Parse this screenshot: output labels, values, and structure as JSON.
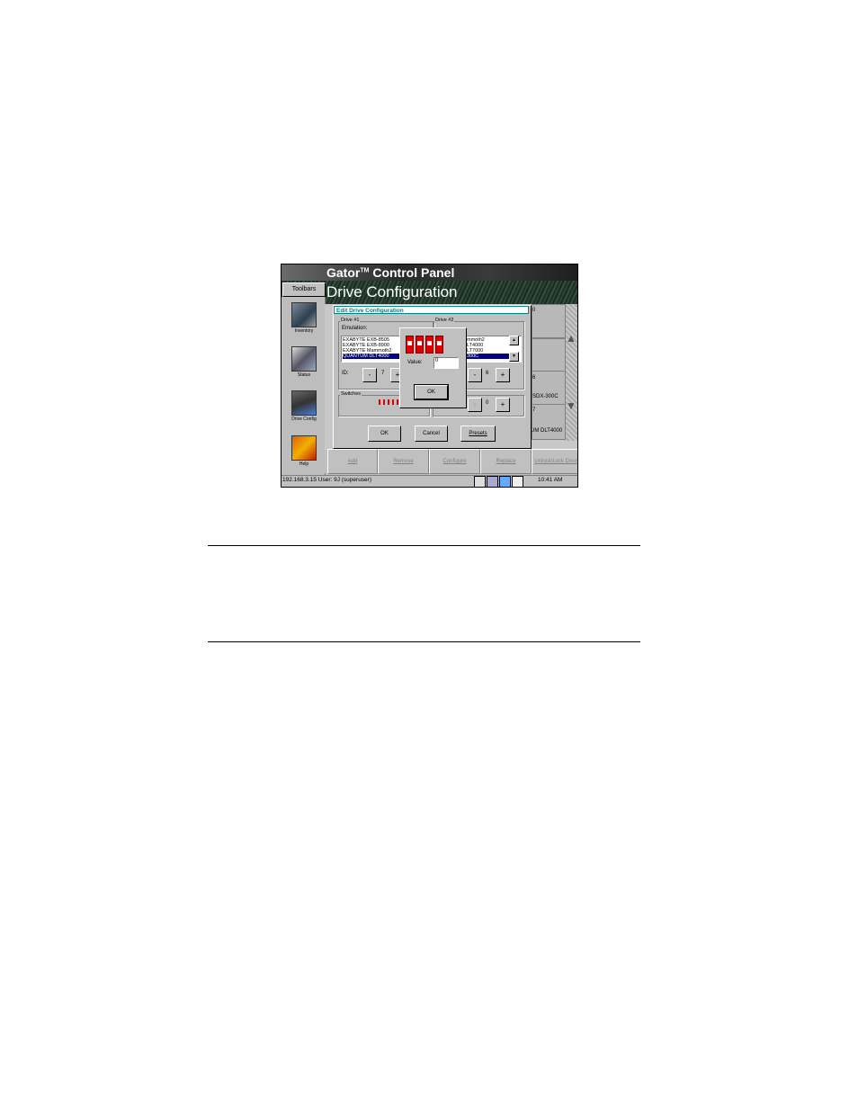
{
  "header": {
    "app_title": "Gator",
    "tm": "TM",
    "app_title_rest": " Control Panel",
    "page_title": "Drive Configuration",
    "toolbars_label": "Toolbars"
  },
  "toolbar": {
    "items": [
      {
        "label": "Inventory",
        "icon": "inventory-icon"
      },
      {
        "label": "Status",
        "icon": "status-icon"
      },
      {
        "label": "Drive Config",
        "icon": "drive-config-icon"
      },
      {
        "label": "Help",
        "icon": "help-icon"
      }
    ]
  },
  "slots": {
    "s0": "0",
    "s6": "6",
    "s6_name": "SDX-300C",
    "s7": "7",
    "s7_name": "UM DLT4000"
  },
  "bottom_buttons": {
    "add": "Add",
    "remove": "Remove",
    "configure": "Configure",
    "replace": "Replace",
    "unlock": "Unlock/Lock Door"
  },
  "status": {
    "text": "192.168.3.15  User: 9J (superuser)",
    "clock": "10:41 AM"
  },
  "dialog": {
    "title": "Edit Drive Configuration",
    "drive1": {
      "label": "Drive #1",
      "emulation_label": "Emulation:",
      "items": [
        "EXABYTE EXB-8505",
        "EXABYTE EXB-8900",
        "EXABYTE Mammoth2",
        "QUANTUM DLT4000"
      ],
      "id_label": "ID:",
      "id_value": "7",
      "minus": "-",
      "plus": "+"
    },
    "drive2": {
      "label": "Drive #2",
      "items": [
        "mmoth2",
        "LT4000",
        "LT7000",
        "300C"
      ],
      "id_value": "6",
      "minus": "-",
      "plus": "+"
    },
    "switches_label": "Switches",
    "switch2_value": "0",
    "ok": "OK",
    "cancel": "Cancel",
    "presets": "Presets",
    "popup": {
      "value_label": "Value:",
      "value": "0",
      "ok": "OK"
    }
  }
}
